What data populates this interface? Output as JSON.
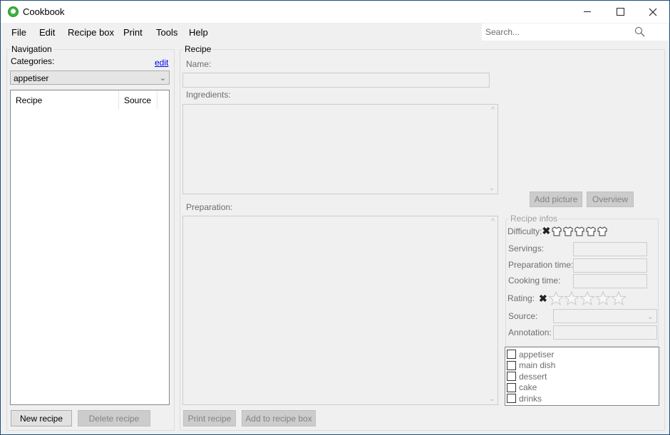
{
  "window": {
    "title": "Cookbook",
    "controls": {
      "minimize": "minimize",
      "maximize": "maximize",
      "close": "close"
    }
  },
  "menu": [
    "File",
    "Edit",
    "Recipe box",
    "Print",
    "Tools",
    "Help"
  ],
  "search": {
    "placeholder": "Search...",
    "icon": "search-icon"
  },
  "navigation": {
    "group_label": "Navigation",
    "categories_label": "Categories:",
    "edit_link": "edit",
    "category_selected": "appetiser",
    "list_columns": [
      "Recipe",
      "Source"
    ],
    "new_button": "New recipe",
    "delete_button": "Delete recipe"
  },
  "recipe": {
    "group_label": "Recipe",
    "name_label": "Name:",
    "name_value": "",
    "ingredients_label": "Ingredients:",
    "preparation_label": "Preparation:",
    "add_picture_button": "Add picture",
    "overview_button": "Overview",
    "print_button": "Print recipe",
    "add_to_box_button": "Add to recipe box",
    "infos": {
      "group_label": "Recipe infos",
      "difficulty_label": "Difficulty:",
      "difficulty_value": 0,
      "difficulty_max": 5,
      "servings_label": "Servings:",
      "servings_value": "",
      "prep_time_label": "Preparation time:",
      "prep_time_value": "",
      "cooking_time_label": "Cooking time:",
      "cooking_time_value": "",
      "rating_label": "Rating:",
      "rating_value": 0,
      "rating_max": 5,
      "source_label": "Source:",
      "source_value": "",
      "annotation_label": "Annotation:",
      "annotation_value": ""
    },
    "categories": [
      {
        "label": "appetiser",
        "checked": false
      },
      {
        "label": "main dish",
        "checked": false
      },
      {
        "label": "dessert",
        "checked": false
      },
      {
        "label": "cake",
        "checked": false
      },
      {
        "label": "drinks",
        "checked": false
      }
    ]
  }
}
